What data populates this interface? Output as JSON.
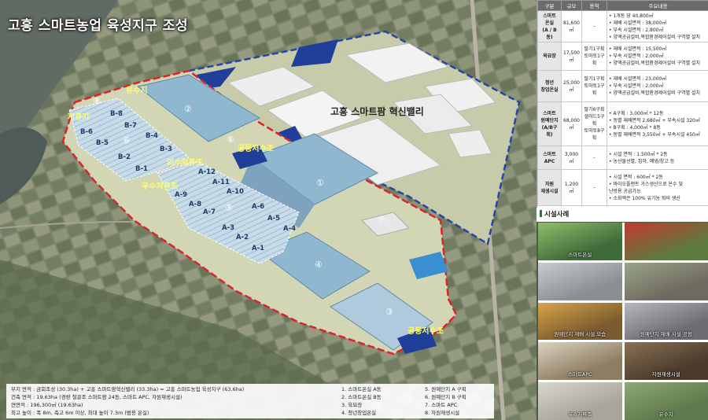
{
  "title": "고흥 스마트농업 육성지구 조성",
  "map": {
    "park_name": "고흥 스마트팜 혁신밸리",
    "labels": {
      "reservoir_top": "유수지",
      "reservoir_left": "저류지",
      "common_tank_1": "공동저수조",
      "common_tank_2": "공동저수조",
      "outer_tank": "외수저류조",
      "inner_tank": "우수저류조"
    },
    "numbers": [
      "①",
      "②",
      "③",
      "④",
      "⑤",
      "⑥",
      "⑦",
      "⑧",
      "⑧"
    ],
    "zones_b": [
      "B-8",
      "B-7",
      "B-6",
      "B-5",
      "B-4",
      "B-3",
      "B-2",
      "B-1"
    ],
    "zones_a": [
      "A-12",
      "A-11",
      "A-10",
      "A-9",
      "A-8",
      "A-7",
      "A-6",
      "A-5",
      "A-4",
      "A-3",
      "A-2",
      "A-1"
    ]
  },
  "table": {
    "headers": [
      "구분",
      "규모",
      "용역",
      "주요내용"
    ],
    "rows": [
      {
        "cat": [
          "스마트",
          "온실",
          "(A / B동)"
        ],
        "size": "81,600㎡",
        "crop": [
          "-"
        ],
        "details": [
          "• 1개동 당 40,800㎡",
          "• 재배 시설면적 : 38,000㎡",
          "• 부속 시설면적 : 2,800㎡",
          "• 양액공급설비,복합환경제어설비 구역별 설치"
        ]
      },
      {
        "cat": [
          "육묘장"
        ],
        "size": "17,500㎡",
        "crop": [
          "딸기1구획",
          "토마토1구획"
        ],
        "details": [
          "• 재배 시설면적 : 15,500㎡",
          "• 부속 시설면적 : 2,000㎡",
          "• 양액공급설비,복합환경제어설비 구역별 설치"
        ]
      },
      {
        "cat": [
          "청년",
          "창업온실"
        ],
        "size": "25,000㎡",
        "crop": [
          "딸기1구획",
          "토마토1구획"
        ],
        "details": [
          "• 재배 시설면적 : 23,000㎡",
          "• 부속 시설면적 : 2,000㎡",
          "• 양액공급설비,복합환경제어설비 구역별 설치"
        ]
      },
      {
        "cat": [
          "스마트",
          "원예단지",
          "(A/B구획)"
        ],
        "size": "68,000㎡",
        "crop": [
          "딸기6구획",
          "샐러드5구획",
          "토마토8구획"
        ],
        "details": [
          "• A구획 : 3,000㎡ * 12동",
          "• 동별 재배면적 2,680㎡ + 부속시설 320㎡",
          "• B구획 : 4,000㎡ * 8동",
          "• 동별 재배면적 3,550㎡ + 부속시설 450㎡"
        ]
      },
      {
        "cat": [
          "스마트",
          "APC"
        ],
        "size": "3,000㎡",
        "crop": [
          "-"
        ],
        "details": [
          "• 시설 면적 : 1,500㎡ * 2동",
          "• 농산물선별, 집하, 예냉/창고 등"
        ]
      },
      {
        "cat": [
          "자원",
          "재생시설"
        ],
        "size": "1,200㎡",
        "crop": [
          "-"
        ],
        "details": [
          "• 시설 면적 : 600㎡ * 2동",
          "• 바이오플랜트 가스생산으로 온수 및",
          "  난방용 공급가능",
          "• 소화액은 100% 유기농 퇴비 생산"
        ]
      }
    ]
  },
  "facilities": {
    "heading": "시설사례",
    "photos": [
      {
        "caption": "스마트온실",
        "icon": "greenhouse-photo"
      },
      {
        "caption": "",
        "icon": "tomato-greenhouse-photo"
      },
      {
        "caption": "",
        "icon": "nursery-photo"
      },
      {
        "caption": "",
        "icon": "seedling-photo"
      },
      {
        "caption": "원예단지 재배 시설 모습",
        "icon": "packing-photo"
      },
      {
        "caption": "원예단지 재배 시설 공정",
        "icon": "lab-photo"
      },
      {
        "caption": "스마트APC",
        "icon": "apc-photo"
      },
      {
        "caption": "자원재생시설",
        "icon": "compost-photo"
      },
      {
        "caption": "우수저류조",
        "icon": "tank-photo"
      },
      {
        "caption": "유수지",
        "icon": "pond-photo"
      }
    ]
  },
  "info": {
    "lines": [
      "부지 면적 : 금회조성 (30.3ha) + 고흥 스마트팜혁신밸리 (33.3ha) = 고흥 스마트농업 육성지구 (63.6ha)",
      "건축 면적 : 19.63ha (경량 철골조 스마트팜 24동, 스마트 APC, 자원재생시설)",
      "연면적 : 196,300㎡ (19.63ha)",
      "최고 높이 : 폭 8m, 측고 6m 이상, 최대 높이 7.3m (범용 온실)"
    ],
    "legend_left": [
      "1. 스마트온실 A동",
      "2. 스마트온실 B동",
      "3. 육묘장",
      "4. 청년창업온실"
    ],
    "legend_right": [
      "5. 원예단지 A 구획",
      "6. 원예단지 B 구획",
      "7. 스마트 APC",
      "8. 자원재생시설"
    ]
  },
  "colors": {
    "red_boundary": "#d9242b",
    "blue_boundary": "#2346a8",
    "greenhouse": "#8fb7cf",
    "table_header": "#6b6b6b"
  }
}
